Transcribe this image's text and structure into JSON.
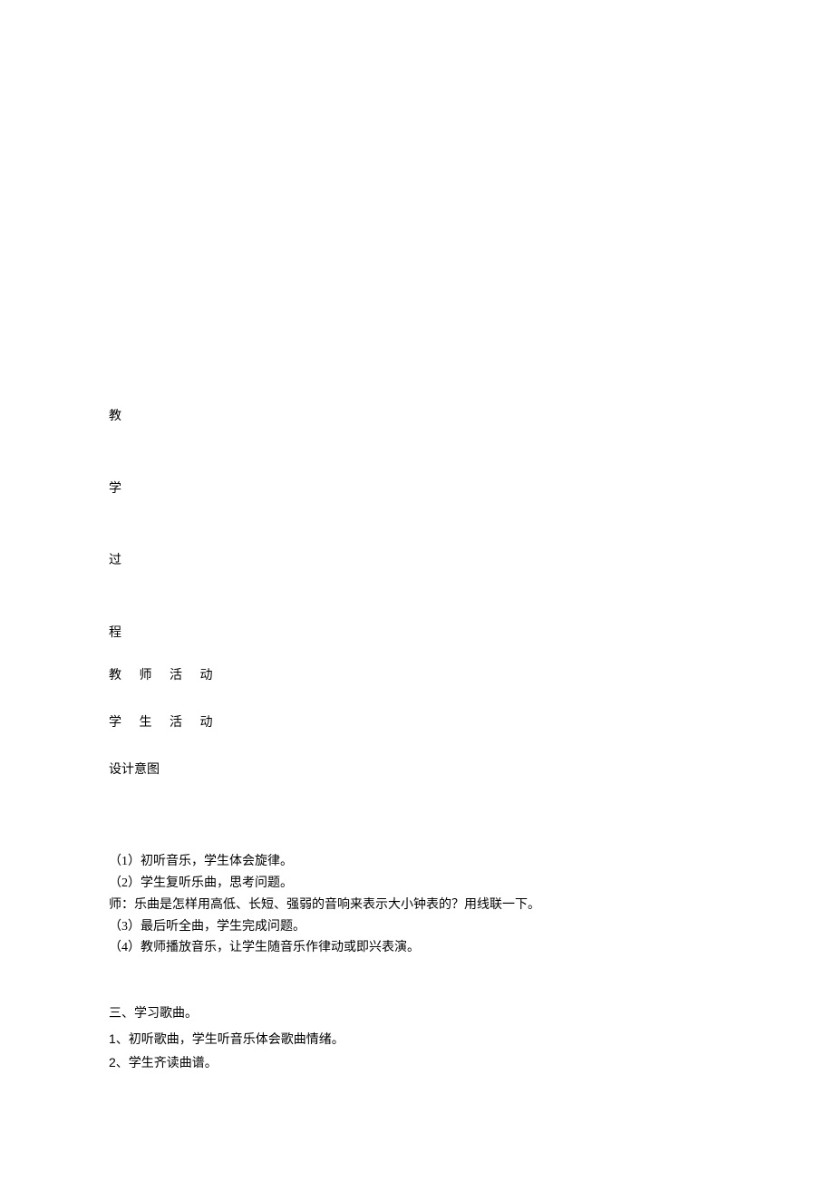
{
  "vertical_header": {
    "char1": "教",
    "char2": "学",
    "char3": "过",
    "char4": "程"
  },
  "labels": {
    "teacher_activity": "教 师 活 动",
    "student_activity": "学 生 活 动",
    "design_intent": "设计意图"
  },
  "content": {
    "item1": "（1）初听音乐，学生体会旋律。",
    "item2": "（2）学生复听乐曲，思考问题。",
    "teacher_note": "师：乐曲是怎样用高低、长短、强弱的音响来表示大小钟表的？用线联一下。",
    "item3": "（3）最后听全曲，学生完成问题。",
    "item4": "（4）教师播放音乐，让学生随音乐作律动或即兴表演。"
  },
  "section3": {
    "title": "三、学习歌曲。",
    "line1": "1、初听歌曲，学生听音乐体会歌曲情绪。",
    "line2": "2、学生齐读曲谱。"
  }
}
